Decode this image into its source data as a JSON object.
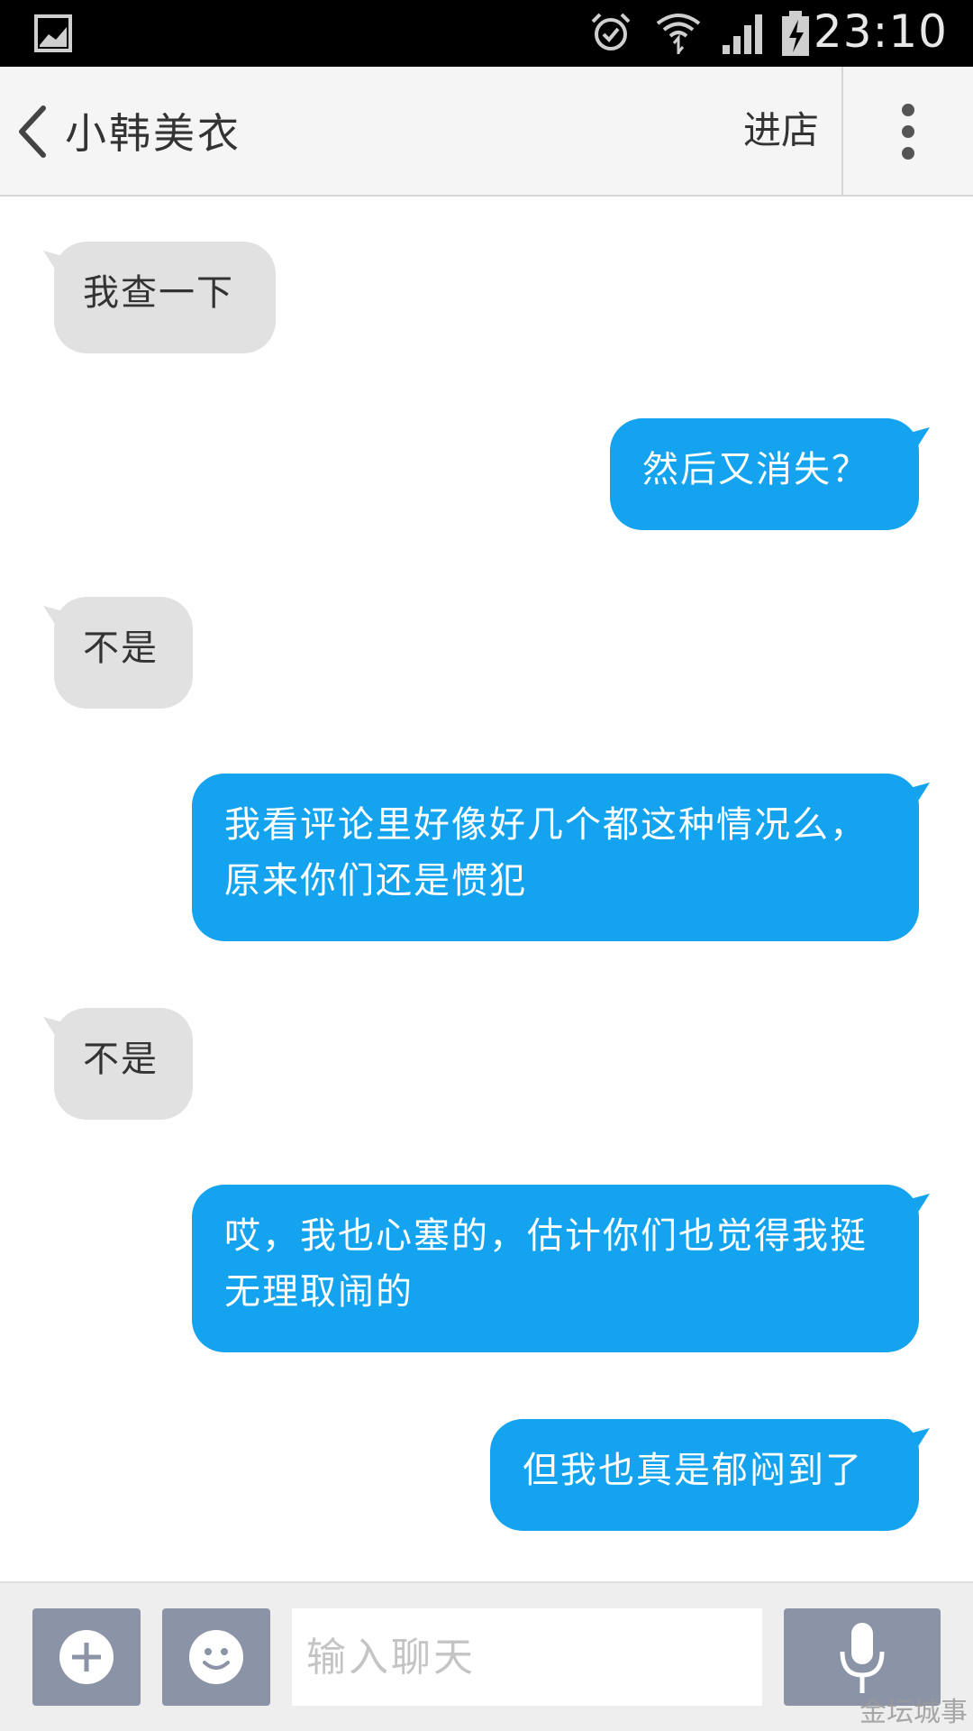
{
  "status_bar": {
    "time": "23:10",
    "icons": [
      "gallery-icon",
      "alarm-icon",
      "wifi-icon",
      "signal-icon",
      "battery-charging-icon"
    ]
  },
  "header": {
    "title": "小韩美衣",
    "enter_store_label": "进店",
    "back_icon": "chevron-left-icon",
    "more_icon": "more-vertical-icon"
  },
  "messages": [
    {
      "side": "in",
      "text": "我查一下"
    },
    {
      "side": "out",
      "text": "然后又消失？"
    },
    {
      "side": "in",
      "text": "不是"
    },
    {
      "side": "out",
      "text": "我看评论里好像好几个都这种情况么，原来你们还是惯犯"
    },
    {
      "side": "in",
      "text": "不是"
    },
    {
      "side": "out",
      "text": "哎，我也心塞的，估计你们也觉得我挺无理取闹的"
    },
    {
      "side": "out",
      "text": "但我也真是郁闷到了"
    }
  ],
  "input_bar": {
    "placeholder": "输入聊天",
    "add_icon": "plus-icon",
    "emoji_icon": "smiley-icon",
    "voice_icon": "microphone-icon"
  },
  "watermark": "金坛城事",
  "colors": {
    "outgoing_bubble": "#14a3ee",
    "incoming_bubble": "#e1e1e1",
    "tool_button": "#8b93a6"
  }
}
